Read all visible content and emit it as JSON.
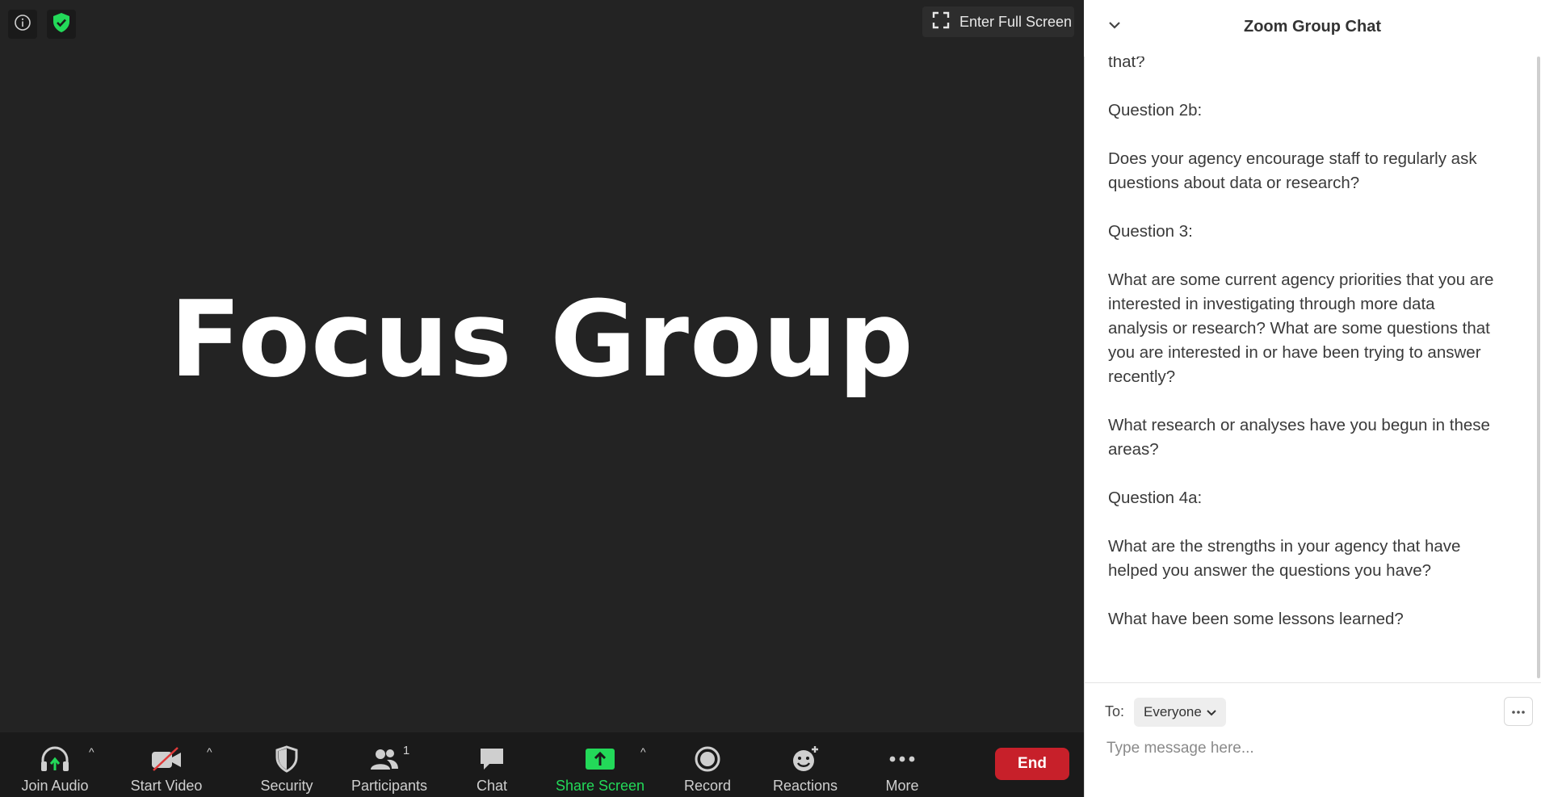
{
  "meeting": {
    "fullscreen_label": "Enter Full Screen",
    "share_title": "Focus Group"
  },
  "toolbar": {
    "join_audio": "Join Audio",
    "start_video": "Start Video",
    "security": "Security",
    "participants": "Participants",
    "participants_count": "1",
    "chat": "Chat",
    "share_screen": "Share Screen",
    "record": "Record",
    "reactions": "Reactions",
    "more": "More",
    "end": "End"
  },
  "chat": {
    "title": "Zoom Group Chat",
    "messages": [
      "that?",
      "Question 2b:",
      "Does your agency encourage staff to regularly ask questions about data or research?",
      "Question 3:",
      "What are some current agency priorities that you are interested in investigating through more data analysis or research? What are some questions that you are interested in or have been trying to answer recently?",
      "What research or analyses have you begun in these areas?",
      "Question 4a:",
      "What are the strengths in your agency that have helped you answer the questions you have?",
      "What have been some lessons learned?"
    ],
    "to_label": "To:",
    "recipient": "Everyone",
    "input_placeholder": "Type message here..."
  },
  "colors": {
    "accent_green": "#23d959",
    "end_red": "#c7202a",
    "meeting_bg": "#232323",
    "toolbar_bg": "#1a1a1a"
  }
}
